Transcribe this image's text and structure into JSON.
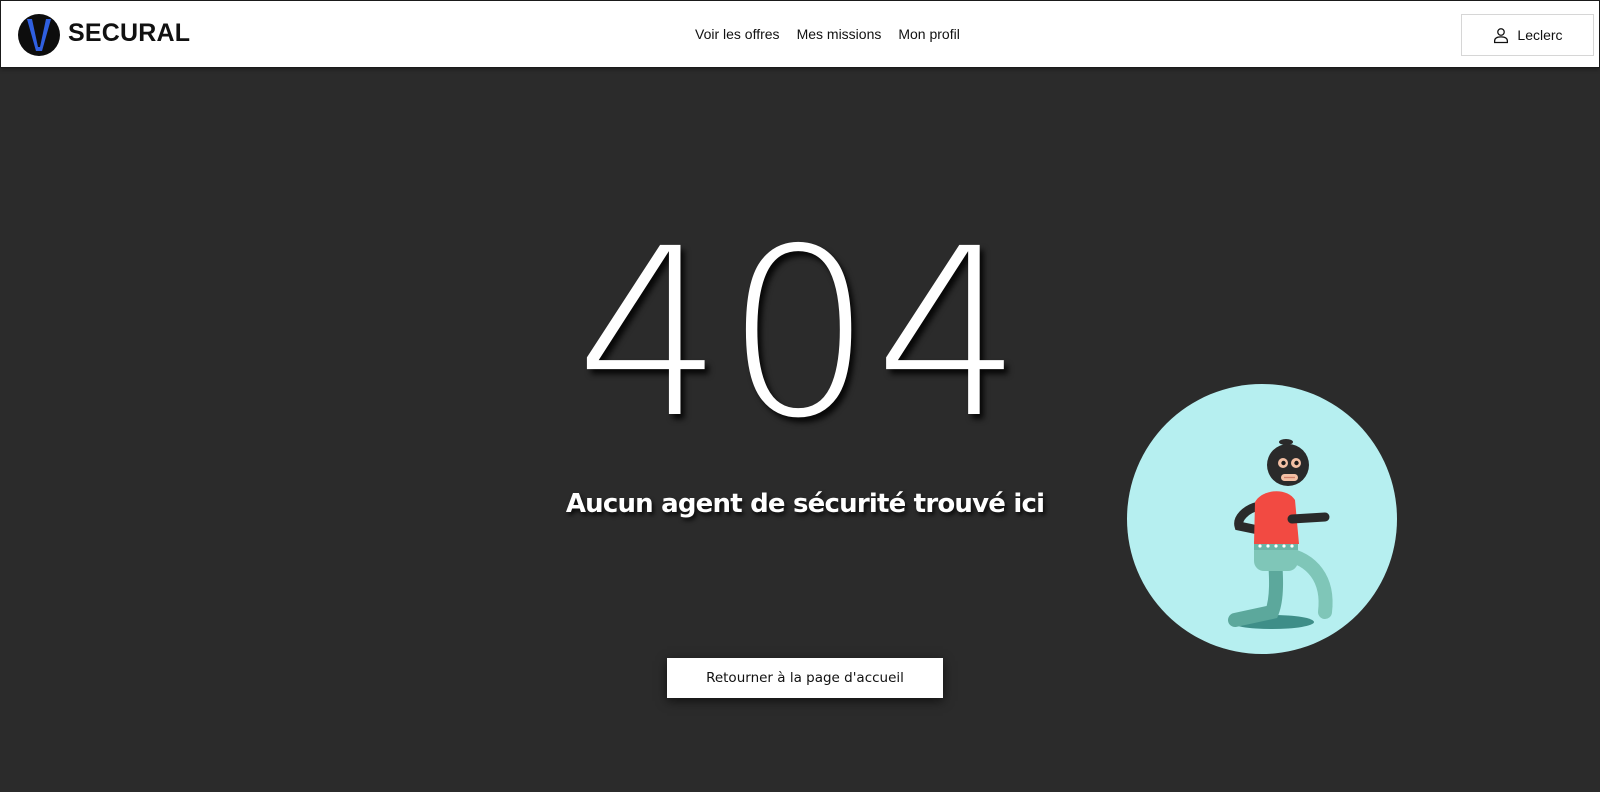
{
  "header": {
    "brand": "SECURAL",
    "nav": [
      "Voir les offres",
      "Mes missions",
      "Mon profil"
    ],
    "user_label": "Leclerc"
  },
  "error": {
    "code": "404",
    "message": "Aucun agent de sécurité trouvé ici",
    "home_button": "Retourner à la page d'accueil"
  },
  "icons": {
    "logo": "secural-logo-icon",
    "user": "user-icon",
    "illustration": "masked-burglar-running-illustration"
  },
  "colors": {
    "page_background": "#2b2b2b",
    "header_background": "#ffffff",
    "logo_accent": "#2f5fe0",
    "illustration_circle": "#b6eff0",
    "burglar_shirt": "#f24a42",
    "burglar_pants": "#7fc6b8"
  }
}
